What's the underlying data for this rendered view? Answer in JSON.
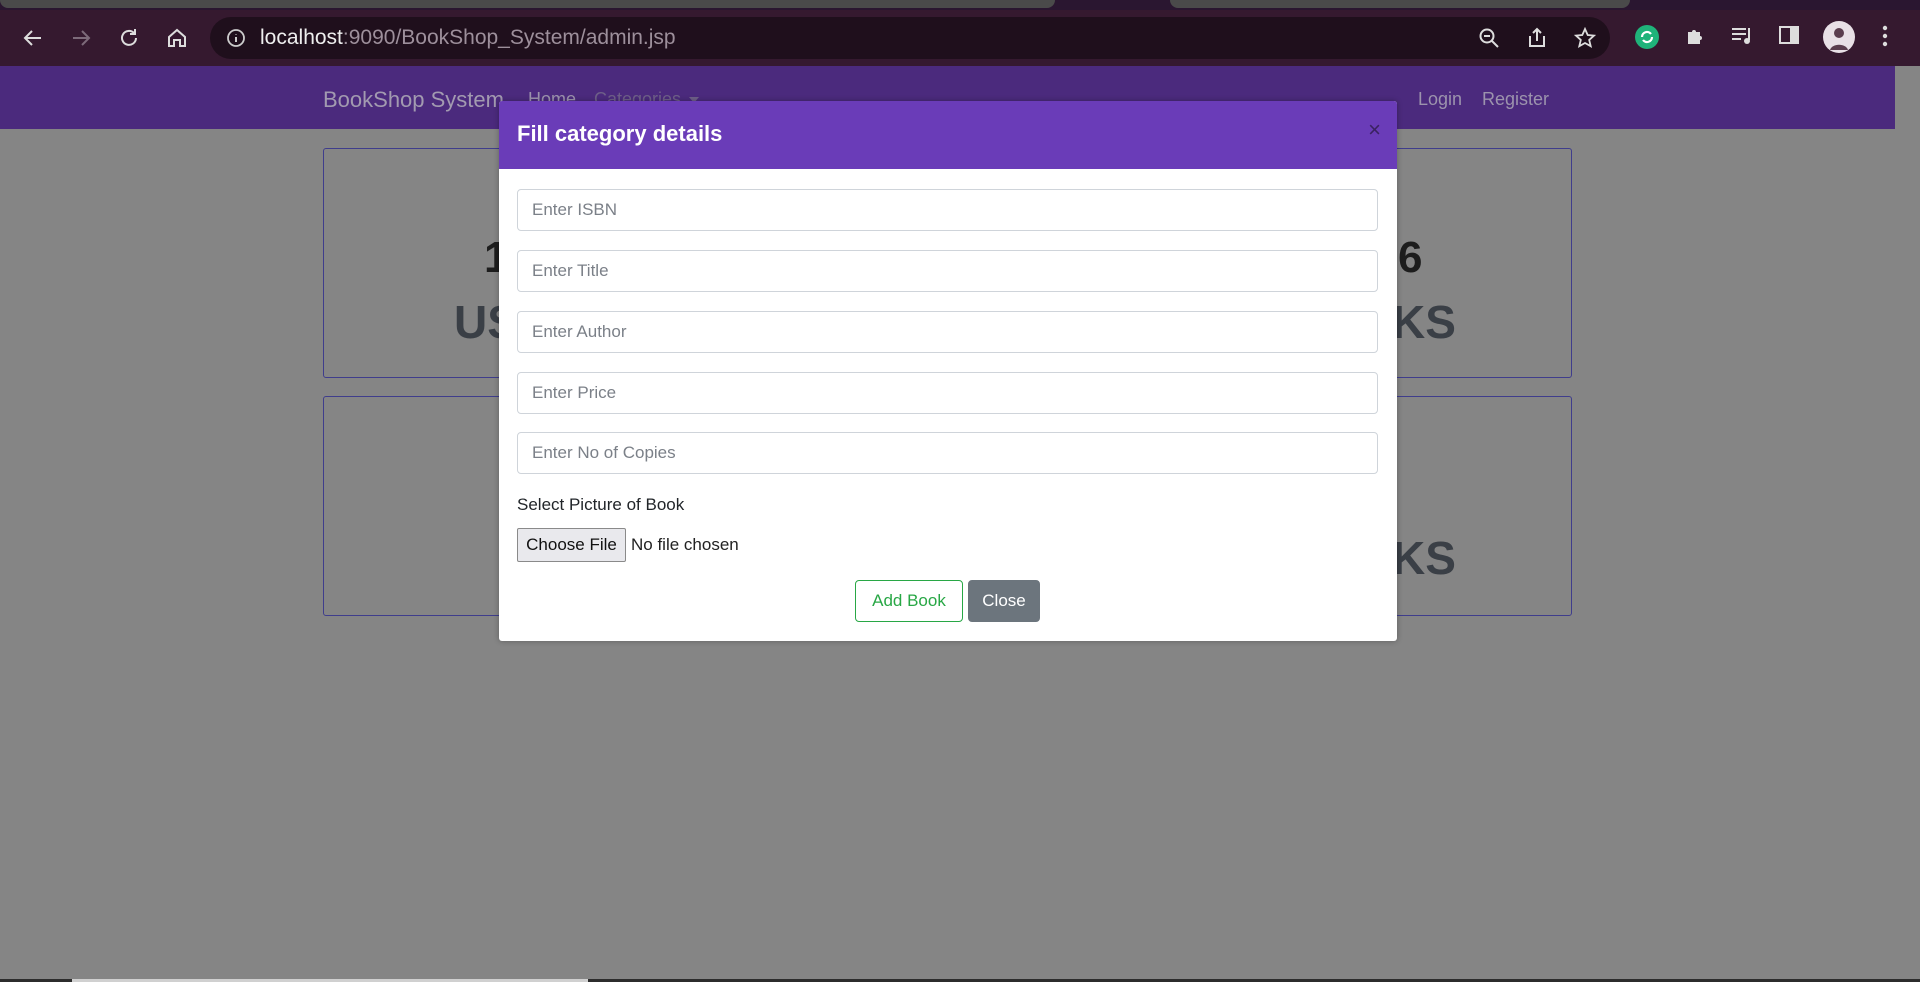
{
  "browser": {
    "url_host": "localhost",
    "url_rest": ":9090/BookShop_System/admin.jsp"
  },
  "navbar": {
    "brand": "BookShop System",
    "home": "Home",
    "categories": "Categories",
    "login": "Login",
    "register": "Register"
  },
  "cards": {
    "users_count_partial": "1",
    "users_label_partial": "US",
    "books_count_partial": "6",
    "books_label_partial": "KS",
    "card2_label_partial": "KS"
  },
  "modal": {
    "title": "Fill category details",
    "close_symbol": "×",
    "isbn_placeholder": "Enter ISBN",
    "title_placeholder": "Enter Title",
    "author_placeholder": "Enter Author",
    "price_placeholder": "Enter Price",
    "copies_placeholder": "Enter No of Copies",
    "picture_label": "Select Picture of Book",
    "choose_file": "Choose File",
    "no_file": "No file chosen",
    "add_button": "Add Book",
    "close_button": "Close"
  },
  "colors": {
    "navbar": "#4b2a7d",
    "modal_header": "#6a3cb8",
    "success": "#28a745",
    "secondary": "#6c757d"
  }
}
